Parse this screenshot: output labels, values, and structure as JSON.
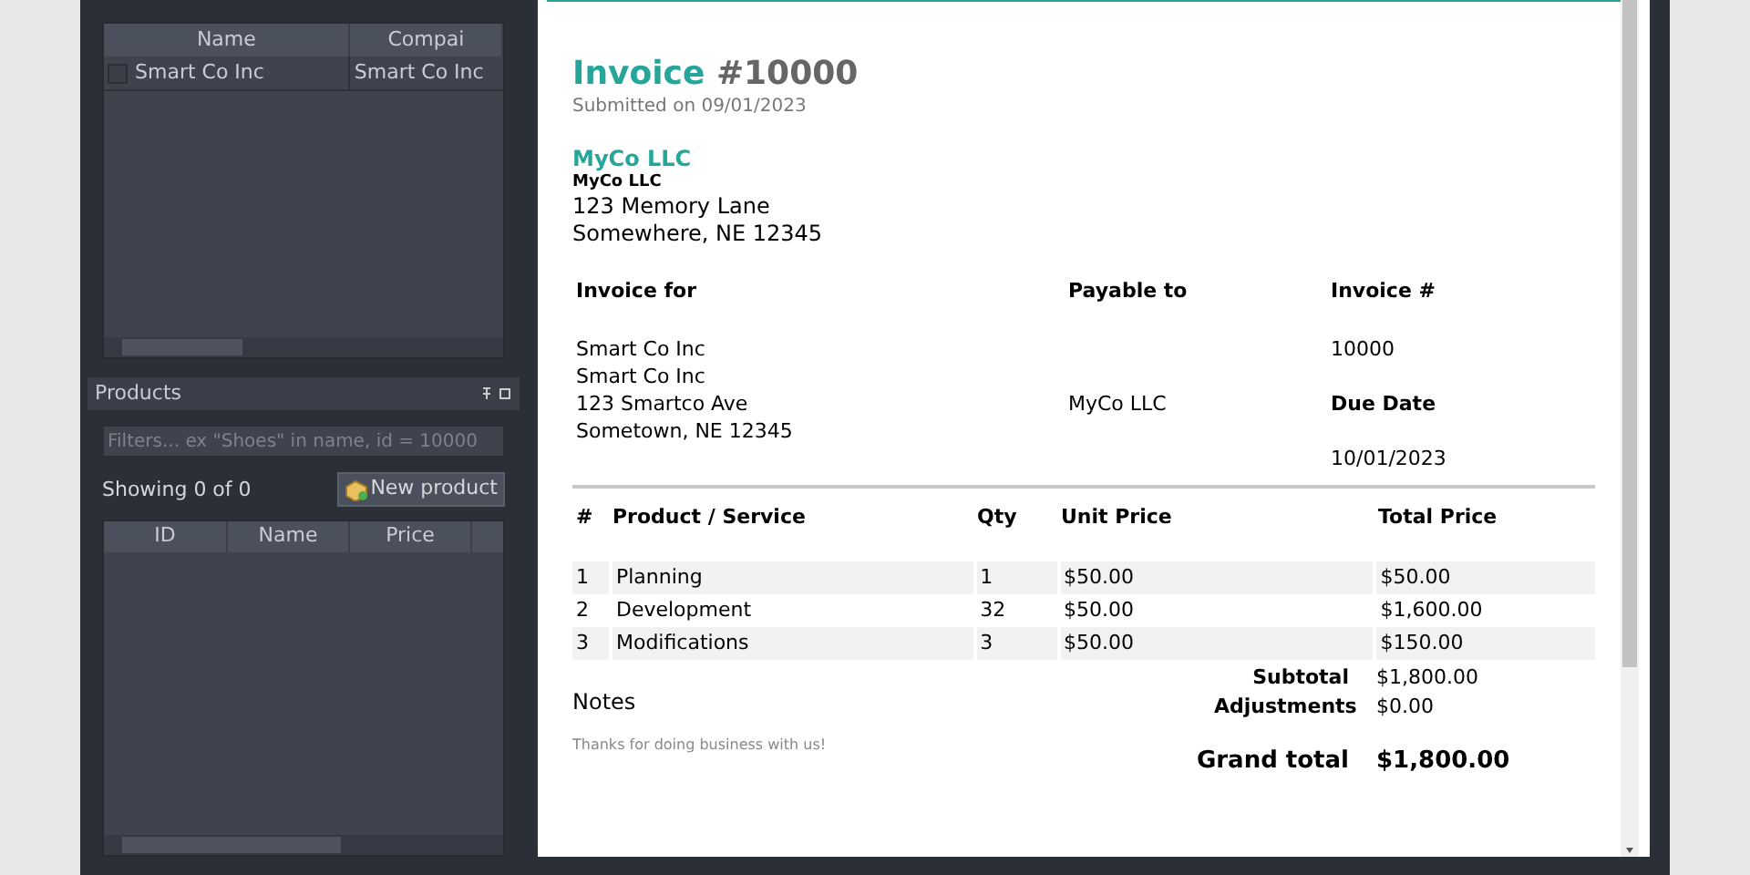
{
  "customers_table": {
    "columns": [
      "Name",
      "Compai"
    ],
    "rows": [
      {
        "checked": false,
        "cells": [
          "Smart Co Inc",
          "Smart Co Inc"
        ]
      }
    ]
  },
  "products_panel": {
    "title": "Products",
    "filter": {
      "placeholder": "Filters... ex \"Shoes\" in name, id = 10000"
    },
    "count": "Showing 0 of 0",
    "new_button": "New product",
    "columns": [
      "ID",
      "Name",
      "Price"
    ]
  },
  "invoice": {
    "title": "Invoice",
    "number": "#10000",
    "submitted": "Submitted on 09/01/2023",
    "company_heading": "MyCo LLC",
    "company_lines": [
      "MyCo LLC",
      "123 Memory Lane",
      "Somewhere, NE 12345"
    ],
    "bill_to": {
      "heading": "Invoice for",
      "lines": [
        "Smart Co Inc",
        "Smart Co Inc",
        "123 Smartco Ave",
        "Sometown, NE 12345"
      ]
    },
    "payable_to": {
      "heading": "Payable to",
      "value": "MyCo LLC"
    },
    "invoice_no": {
      "heading": "Invoice #",
      "value": "10000"
    },
    "due_date": {
      "heading": "Due Date",
      "value": "10/01/2023"
    },
    "columns": [
      "#",
      "Product / Service",
      "Qty",
      "Unit Price",
      "Total Price"
    ],
    "items": [
      [
        "1",
        "Planning",
        "1",
        "$50.00",
        "$50.00"
      ],
      [
        "2",
        "Development",
        "32",
        "$50.00",
        "$1,600.00"
      ],
      [
        "3",
        "Modifications",
        "3",
        "$50.00",
        "$150.00"
      ]
    ],
    "totals": [
      {
        "label": "Subtotal",
        "value": "$1,800.00"
      },
      {
        "label": "Adjustments",
        "value": "$0.00"
      }
    ],
    "notes_heading": "Notes",
    "notes": "Thanks for doing business with us!",
    "grand_total": {
      "label": "Grand total",
      "value": "$1,800.00"
    }
  }
}
